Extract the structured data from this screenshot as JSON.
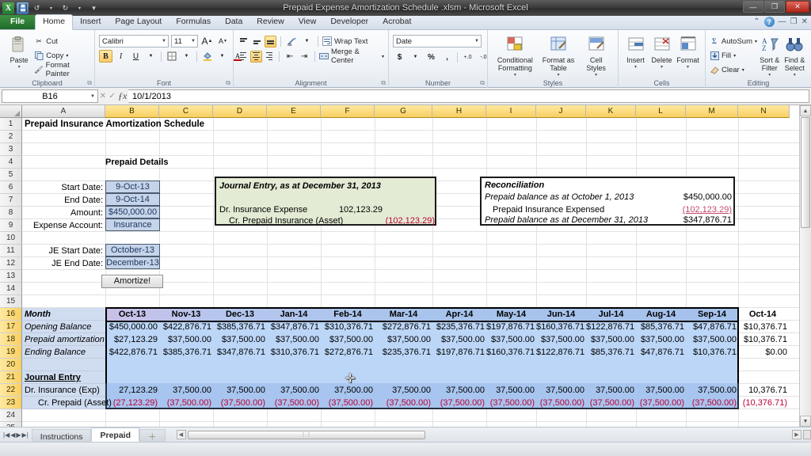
{
  "window": {
    "title": "Prepaid Expense Amortization Schedule .xlsm - Microsoft Excel",
    "minimize": "—",
    "restore": "❐",
    "close": "✕",
    "qat": {
      "logo": "X",
      "save": "save-icon",
      "undo": "↺",
      "redo": "↻",
      "customize": "▾"
    },
    "help": {
      "ribbon_up": "⌃",
      "question": "?",
      "minimize": "—",
      "restore": "❐",
      "close": "✕"
    }
  },
  "ribbon": {
    "tabs": [
      {
        "label": "File",
        "active": false,
        "file": true
      },
      {
        "label": "Home",
        "active": true
      },
      {
        "label": "Insert",
        "active": false
      },
      {
        "label": "Page Layout",
        "active": false
      },
      {
        "label": "Formulas",
        "active": false
      },
      {
        "label": "Data",
        "active": false
      },
      {
        "label": "Review",
        "active": false
      },
      {
        "label": "View",
        "active": false
      },
      {
        "label": "Developer",
        "active": false
      },
      {
        "label": "Acrobat",
        "active": false
      }
    ],
    "clipboard": {
      "group_label": "Clipboard",
      "paste": "Paste",
      "cut": "Cut",
      "copy": "Copy",
      "format_painter": "Format Painter",
      "dialog_launcher": "⧉"
    },
    "font": {
      "group_label": "Font",
      "font_name": "Calibri",
      "font_size": "11",
      "grow_font": "A",
      "shrink_font": "A",
      "bold": "B",
      "italic": "I",
      "underline": "U",
      "borders": "▦",
      "fill_color": "A",
      "font_color": "A",
      "dialog_launcher": "⧉"
    },
    "alignment": {
      "group_label": "Alignment",
      "orientation": "≫",
      "wrap_text": "Wrap Text",
      "merge_center": "Merge & Center",
      "decrease_indent": "⇤",
      "increase_indent": "⇥",
      "dialog_launcher": "⧉"
    },
    "number": {
      "group_label": "Number",
      "format": "Date",
      "currency": "$",
      "percent": "%",
      "comma": ",",
      "increase_decimal": "+.0",
      "decrease_decimal": "-.0",
      "dialog_launcher": "⧉"
    },
    "styles": {
      "group_label": "Styles",
      "conditional_formatting": "Conditional Formatting",
      "format_as_table": "Format as Table",
      "cell_styles": "Cell Styles"
    },
    "cells": {
      "group_label": "Cells",
      "insert": "Insert",
      "delete": "Delete",
      "format": "Format"
    },
    "editing": {
      "group_label": "Editing",
      "autosum": "AutoSum",
      "fill": "Fill",
      "clear": "Clear",
      "sort_filter": "Sort & Filter",
      "find_select": "Find & Select"
    }
  },
  "formula_bar": {
    "name_box": "B16",
    "fx_label": "fx",
    "cancel": "✕",
    "enter": "✓",
    "value": "10/1/2013"
  },
  "grid": {
    "columns": [
      "A",
      "B",
      "C",
      "D",
      "E",
      "F",
      "G",
      "H",
      "I",
      "J",
      "K",
      "L",
      "M",
      "N"
    ],
    "selected_columns": [
      "B",
      "C",
      "D",
      "E",
      "F",
      "G",
      "H",
      "I",
      "J",
      "K",
      "L",
      "M",
      "N"
    ],
    "rows": [
      "1",
      "2",
      "3",
      "4",
      "5",
      "6",
      "7",
      "8",
      "9",
      "10",
      "11",
      "12",
      "13",
      "14",
      "15",
      "16",
      "17",
      "18",
      "19",
      "20",
      "21",
      "22",
      "23",
      "24",
      "25"
    ],
    "selected_rows": [
      "16",
      "17",
      "18",
      "19",
      "20",
      "21",
      "22",
      "23"
    ]
  },
  "sheet": {
    "title": "Prepaid Insurance Amortization Schedule",
    "prepaid_details": {
      "heading": "Prepaid Details",
      "fields": [
        {
          "label": "Start Date:",
          "value": "9-Oct-13"
        },
        {
          "label": "End Date:",
          "value": "9-Oct-14"
        },
        {
          "label": "Amount:",
          "value": "$450,000.00"
        },
        {
          "label": "Expense Account:",
          "value": "Insurance"
        }
      ],
      "je_fields": [
        {
          "label": "JE Start Date:",
          "value": "October-13"
        },
        {
          "label": "JE End Date:",
          "value": "December-13"
        }
      ],
      "amortize_button": "Amortize!"
    },
    "journal_entry_box": {
      "heading": "Journal Entry, as at December 31, 2013",
      "lines": [
        {
          "label": "Dr. Insurance Expense",
          "value": "102,123.29",
          "negative": false
        },
        {
          "label": "Cr. Prepaid Insurance (Asset)",
          "value": "(102,123.29)",
          "negative": true
        }
      ]
    },
    "reconciliation_box": {
      "heading": "Reconciliation",
      "lines": [
        {
          "label": "Prepaid balance as at October 1, 2013",
          "value": "$450,000.00",
          "negative": false,
          "italic": true
        },
        {
          "label": "Prepaid Insurance Expensed",
          "value": "(102,123.29)",
          "negative": true,
          "italic": false
        },
        {
          "label": "Prepaid balance as at December 31, 2013",
          "value": "$347,876.71",
          "negative": false,
          "italic": true
        }
      ]
    },
    "journal_entry_section": {
      "heading": "Journal Entry",
      "rows": [
        {
          "label": "Dr. Insurance (Exp)",
          "negative": false
        },
        {
          "label": "Cr. Prepaid (Asset)",
          "negative": true
        }
      ]
    }
  },
  "chart_data": {
    "type": "table",
    "title": "Prepaid Insurance Amortization Schedule",
    "row_label_header": "Month",
    "categories": [
      "Oct-13",
      "Nov-13",
      "Dec-13",
      "Jan-14",
      "Feb-14",
      "Mar-14",
      "Apr-14",
      "May-14",
      "Jun-14",
      "Jul-14",
      "Aug-14",
      "Sep-14",
      "Oct-14"
    ],
    "series": [
      {
        "name": "Opening Balance",
        "values": [
          "$450,000.00",
          "$422,876.71",
          "$385,376.71",
          "$347,876.71",
          "$310,376.71",
          "$272,876.71",
          "$235,376.71",
          "$197,876.71",
          "$160,376.71",
          "$122,876.71",
          "$85,376.71",
          "$47,876.71",
          "$10,376.71"
        ]
      },
      {
        "name": "Prepaid amortization",
        "values": [
          "$27,123.29",
          "$37,500.00",
          "$37,500.00",
          "$37,500.00",
          "$37,500.00",
          "$37,500.00",
          "$37,500.00",
          "$37,500.00",
          "$37,500.00",
          "$37,500.00",
          "$37,500.00",
          "$37,500.00",
          "$10,376.71"
        ]
      },
      {
        "name": "Ending Balance",
        "values": [
          "$422,876.71",
          "$385,376.71",
          "$347,876.71",
          "$310,376.71",
          "$272,876.71",
          "$235,376.71",
          "$197,876.71",
          "$160,376.71",
          "$122,876.71",
          "$85,376.71",
          "$47,876.71",
          "$10,376.71",
          "$0.00"
        ]
      },
      {
        "name": "Dr. Insurance (Exp)",
        "values": [
          "27,123.29",
          "37,500.00",
          "37,500.00",
          "37,500.00",
          "37,500.00",
          "37,500.00",
          "37,500.00",
          "37,500.00",
          "37,500.00",
          "37,500.00",
          "37,500.00",
          "37,500.00",
          "10,376.71"
        ]
      },
      {
        "name": "Cr. Prepaid (Asset)",
        "values": [
          "(27,123.29)",
          "(37,500.00)",
          "(37,500.00)",
          "(37,500.00)",
          "(37,500.00)",
          "(37,500.00)",
          "(37,500.00)",
          "(37,500.00)",
          "(37,500.00)",
          "(37,500.00)",
          "(37,500.00)",
          "(37,500.00)",
          "(10,376.71)"
        ]
      }
    ]
  },
  "sheet_tabs": {
    "nav": {
      "first": "|◀",
      "prev": "◀",
      "next": "▶",
      "last": "▶|"
    },
    "tabs": [
      {
        "label": "Instructions",
        "active": false
      },
      {
        "label": "Prepaid",
        "active": true
      }
    ],
    "new_sheet": "＋"
  },
  "scrollbars": {
    "h_thumb": "⋮⋮",
    "v_up": "▲",
    "v_down": "▼",
    "h_left": "◀",
    "h_right": "▶"
  },
  "colors": {
    "table_fill": "#bcd6f7",
    "header_band": "#a8c4ec",
    "selection_gold": "#f8cf62",
    "je_box_fill": "#e3ebd4",
    "negative_red": "#c00038",
    "input_fill": "#c5d4e8"
  }
}
